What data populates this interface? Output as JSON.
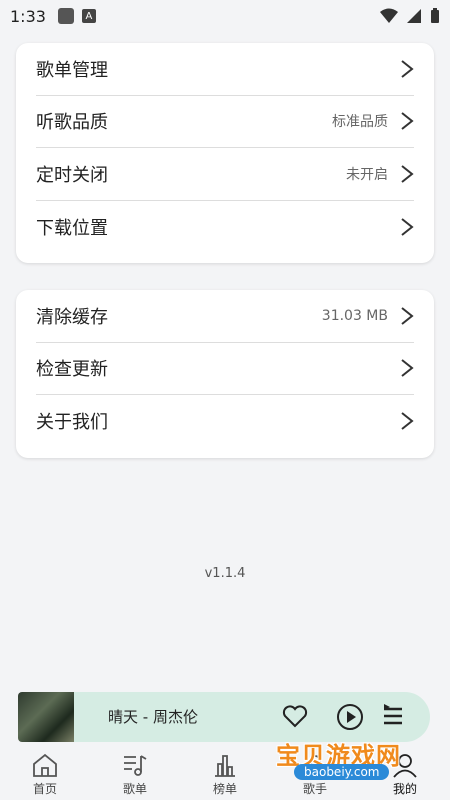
{
  "status_bar": {
    "time": "1:33",
    "notif_icon_letter": "A"
  },
  "settings_group_1": [
    {
      "label": "歌单管理",
      "value": ""
    },
    {
      "label": "听歌品质",
      "value": "标准品质"
    },
    {
      "label": "定时关闭",
      "value": "未开启"
    },
    {
      "label": "下载位置",
      "value": ""
    }
  ],
  "settings_group_2": [
    {
      "label": "清除缓存",
      "value": "31.03 MB"
    },
    {
      "label": "检查更新",
      "value": ""
    },
    {
      "label": "关于我们",
      "value": ""
    }
  ],
  "version": "v1.1.4",
  "player": {
    "song": "晴天 - 周杰伦"
  },
  "tabs": [
    {
      "label": "首页",
      "icon": "home-icon"
    },
    {
      "label": "歌单",
      "icon": "music-list-icon"
    },
    {
      "label": "榜单",
      "icon": "chart-icon"
    },
    {
      "label": "歌手",
      "icon": "singer-icon"
    },
    {
      "label": "我的",
      "icon": "user-icon"
    }
  ],
  "watermark": {
    "text": "宝贝游戏网",
    "url": "baobeiy.com"
  },
  "colors": {
    "accent": "#d5ece3",
    "background": "#f3f4f6",
    "watermark": "#f08a1c"
  }
}
